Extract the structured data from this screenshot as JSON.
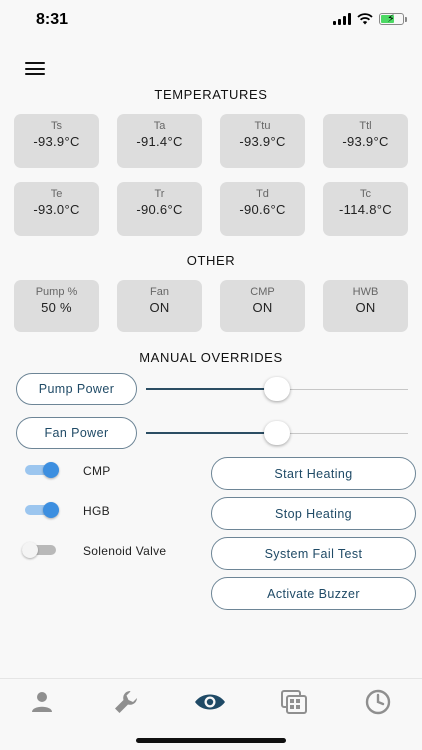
{
  "status_bar": {
    "time": "8:31"
  },
  "sections": {
    "temperatures": "TEMPERATURES",
    "other": "OTHER",
    "manual_overrides": "MANUAL OVERRIDES"
  },
  "temperatures": [
    {
      "label": "Ts",
      "value": "-93.9°C"
    },
    {
      "label": "Ta",
      "value": "-91.4°C"
    },
    {
      "label": "Ttu",
      "value": "-93.9°C"
    },
    {
      "label": "Ttl",
      "value": "-93.9°C"
    },
    {
      "label": "Te",
      "value": "-93.0°C"
    },
    {
      "label": "Tr",
      "value": "-90.6°C"
    },
    {
      "label": "Td",
      "value": "-90.6°C"
    },
    {
      "label": "Tc",
      "value": "-114.8°C"
    }
  ],
  "other": [
    {
      "label": "Pump %",
      "value": "50 %"
    },
    {
      "label": "Fan",
      "value": "ON"
    },
    {
      "label": "CMP",
      "value": "ON"
    },
    {
      "label": "HWB",
      "value": "ON"
    }
  ],
  "overrides": {
    "pump_power": {
      "label": "Pump Power",
      "level": 0.5
    },
    "fan_power": {
      "label": "Fan Power",
      "level": 0.5
    }
  },
  "toggles": [
    {
      "label": "CMP",
      "on": true
    },
    {
      "label": "HGB",
      "on": true
    },
    {
      "label": "Solenoid Valve",
      "on": false
    }
  ],
  "actions": {
    "start_heating": "Start Heating",
    "stop_heating": "Stop Heating",
    "system_fail_test": "System Fail Test",
    "activate_buzzer": "Activate Buzzer"
  },
  "tabs": [
    {
      "icon": "person-icon",
      "active": false
    },
    {
      "icon": "wrench-icon",
      "active": false
    },
    {
      "icon": "eye-icon",
      "active": true
    },
    {
      "icon": "gallery-icon",
      "active": false
    },
    {
      "icon": "clock-icon",
      "active": false
    }
  ],
  "colors": {
    "accent": "#1f4a66",
    "toggle_on": "#3d8fe0",
    "tile_bg": "#dddddd",
    "tab_inactive": "#8f8f8f"
  }
}
